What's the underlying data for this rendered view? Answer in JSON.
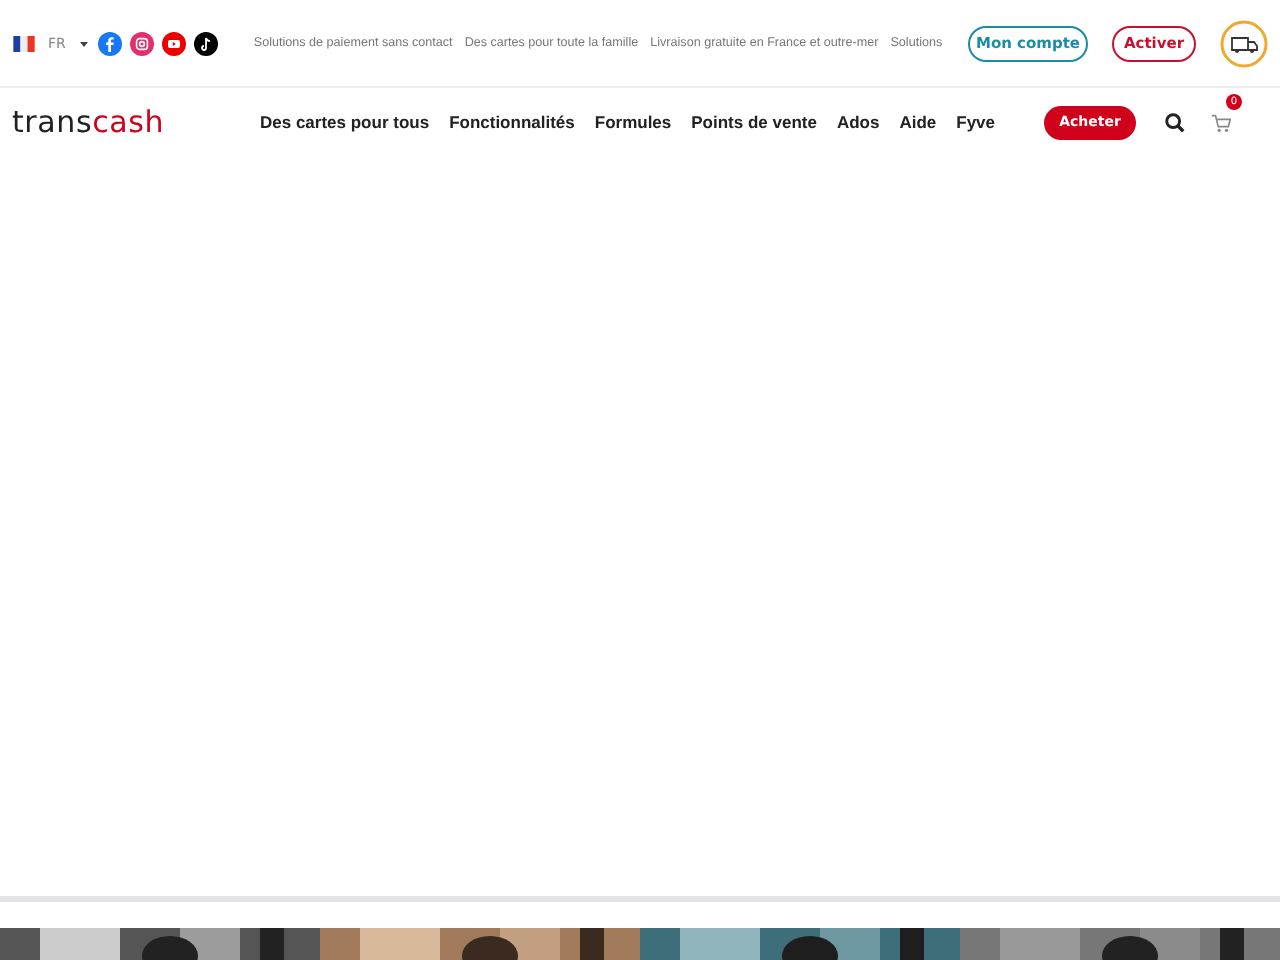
{
  "topbar": {
    "language": "FR",
    "ticker": [
      "Solutions de paiement sans contact",
      "Des cartes pour toute la famille",
      "Livraison gratuite en France et outre-mer",
      "Solutions"
    ],
    "buttons": [
      {
        "label": "Mon compte",
        "kind": "outline-blue"
      },
      {
        "label": "Activer",
        "kind": "outline-red"
      }
    ]
  },
  "header": {
    "logo": {
      "dark": "trans",
      "accent": "cash"
    },
    "nav": [
      "Des cartes pour tous",
      "Fonctionnalités",
      "Formules",
      "Points de vente",
      "Ados",
      "Aide",
      "Fyve"
    ],
    "cta": "Acheter",
    "cart_count": "0"
  }
}
